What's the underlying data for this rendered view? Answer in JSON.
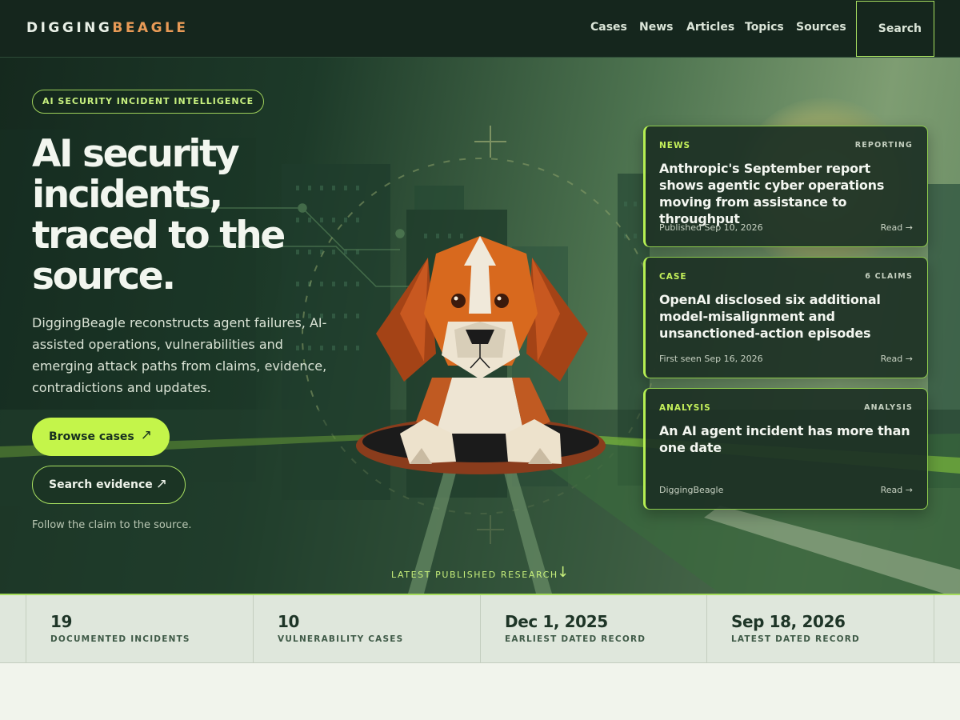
{
  "brand": {
    "part1": "DIGGING",
    "part2": "BEAGLE"
  },
  "nav": {
    "links": [
      "Cases",
      "News",
      "Articles",
      "Topics",
      "Sources"
    ],
    "search_label": "Search"
  },
  "hero": {
    "badge": "AI SECURITY INCIDENT INTELLIGENCE",
    "title": "AI security incidents, traced to the source.",
    "description": "DiggingBeagle reconstructs agent failures, AI-assisted operations, vulnerabilities and emerging attack paths from claims, evidence, contradictions and updates.",
    "primary_button": "Browse cases",
    "secondary_button": "Search evidence",
    "button_arrow": "↗",
    "follow_text": "Follow the claim to the source.",
    "latest_label": "LATEST PUBLISHED RESEARCH",
    "latest_arrow": "↓"
  },
  "cards": [
    {
      "type": "NEWS",
      "tag": "REPORTING",
      "title": "Anthropic's September report shows agentic cyber operations moving from assistance to throughput",
      "meta": "Published Sep 10, 2026",
      "read": "Read →"
    },
    {
      "type": "CASE",
      "tag": "6 CLAIMS",
      "title": "OpenAI disclosed six additional model-misalignment and unsanctioned-action episodes",
      "meta": "First seen Sep 16, 2026",
      "read": "Read →"
    },
    {
      "type": "ANALYSIS",
      "tag": "ANALYSIS",
      "title": "An AI agent incident has more than one date",
      "meta": "DiggingBeagle",
      "read": "Read →"
    }
  ],
  "stats": [
    {
      "value": "19",
      "label": "DOCUMENTED INCIDENTS"
    },
    {
      "value": "10",
      "label": "VULNERABILITY CASES"
    },
    {
      "value": "Dec 1, 2025",
      "label": "EARLIEST DATED RECORD"
    },
    {
      "value": "Sep 18, 2026",
      "label": "LATEST DATED RECORD"
    }
  ],
  "colors": {
    "accent": "#c4f54a",
    "nav_bg": "#15261d",
    "brand_accent": "#e89a56",
    "stats_bg": "#dfe7dc"
  },
  "icons": {
    "mascot": "beagle-illustration",
    "arrow": "arrow-up-right-icon",
    "down": "arrow-down-icon"
  }
}
